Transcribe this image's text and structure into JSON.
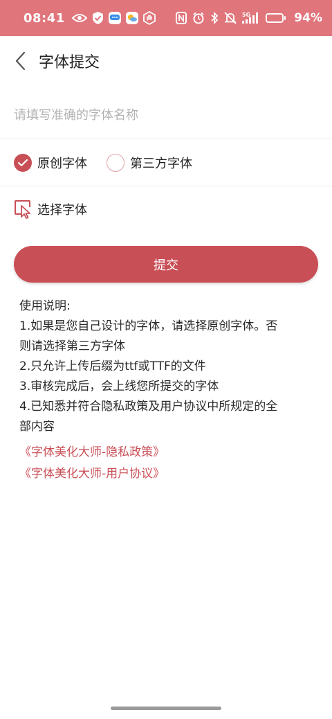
{
  "status_bar": {
    "time": "08:41",
    "network": "5G",
    "battery_percent": "94%",
    "battery_level": 0.94,
    "left_icons": [
      "eye-icon",
      "shield-check-icon",
      "message-app-icon",
      "weather-app-icon",
      "hand-icon"
    ],
    "right_icons": [
      "nfc-icon",
      "alarm-icon",
      "bluetooth-icon",
      "mute-icon",
      "signal-icon",
      "battery-icon"
    ]
  },
  "header": {
    "title": "字体提交",
    "back_icon": "chevron-left-icon"
  },
  "form": {
    "name_placeholder": "请填写准确的字体名称",
    "name_value": "",
    "options": [
      {
        "label": "原创字体",
        "checked": true
      },
      {
        "label": "第三方字体",
        "checked": false
      }
    ],
    "choose_font_label": "选择字体",
    "choose_font_icon": "cursor-select-icon",
    "submit_label": "提交"
  },
  "instructions": {
    "title": "使用说明:",
    "lines": [
      "1.如果是您自己设计的字体，请选择原创字体。否",
      "则请选择第三方字体",
      "2.只允许上传后缀为ttf或TTF的文件",
      "3.审核完成后，会上线您所提交的字体",
      "4.已知悉并符合隐私政策及用户协议中所规定的全",
      "部内容"
    ]
  },
  "links": [
    {
      "label": "《字体美化大师-隐私政策》"
    },
    {
      "label": "《字体美化大师-用户协议》"
    }
  ],
  "colors": {
    "status_bar": "#e0757b",
    "accent": "#c94f57",
    "text": "#222222",
    "placeholder": "#b3b3b3",
    "divider": "#eeeeee"
  }
}
